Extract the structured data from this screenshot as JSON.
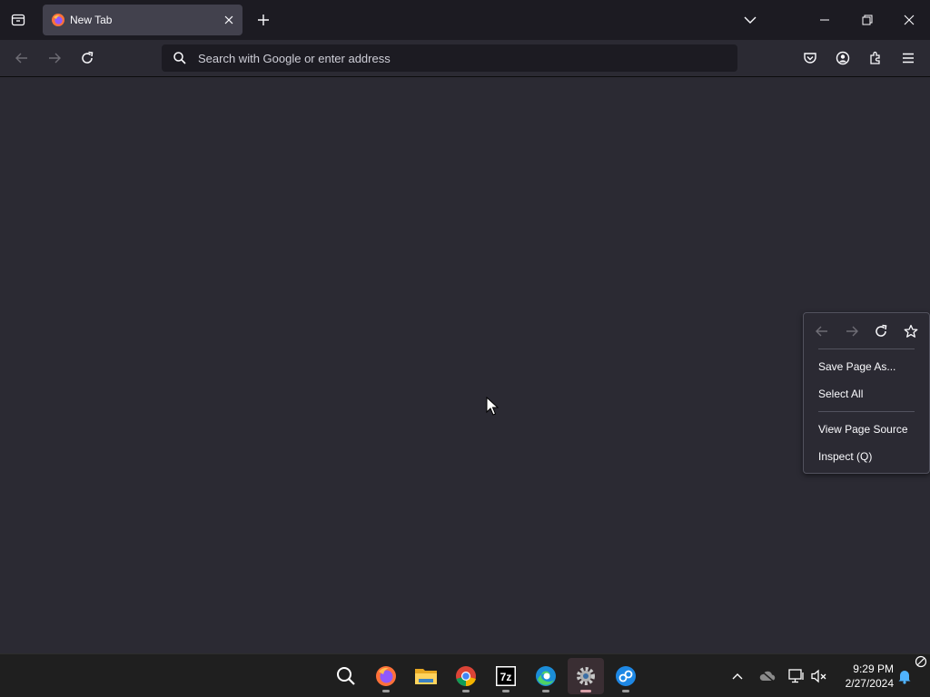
{
  "browser": {
    "tab": {
      "title": "New Tab"
    },
    "urlbar": {
      "placeholder": "Search with Google or enter address",
      "value": ""
    }
  },
  "context_menu": {
    "items": [
      {
        "label": "Save Page As..."
      },
      {
        "label": "Select All"
      },
      {
        "label": "View Page Source"
      },
      {
        "label": "Inspect (Q)"
      }
    ]
  },
  "taskbar": {
    "apps": [
      "search-icon",
      "firefox-icon",
      "file-explorer-icon",
      "chrome-icon",
      "7zip-icon",
      "edge-icon",
      "settings-icon",
      "remote-app-icon"
    ],
    "clock": {
      "time": "9:29 PM",
      "date": "2/27/2024"
    }
  },
  "colors": {
    "tabstrip": "#1c1b22",
    "toolbar": "#2b2a33",
    "active_tab": "#42414d",
    "urlbar": "#1c1b22",
    "taskbar": "#1f1f1f"
  }
}
